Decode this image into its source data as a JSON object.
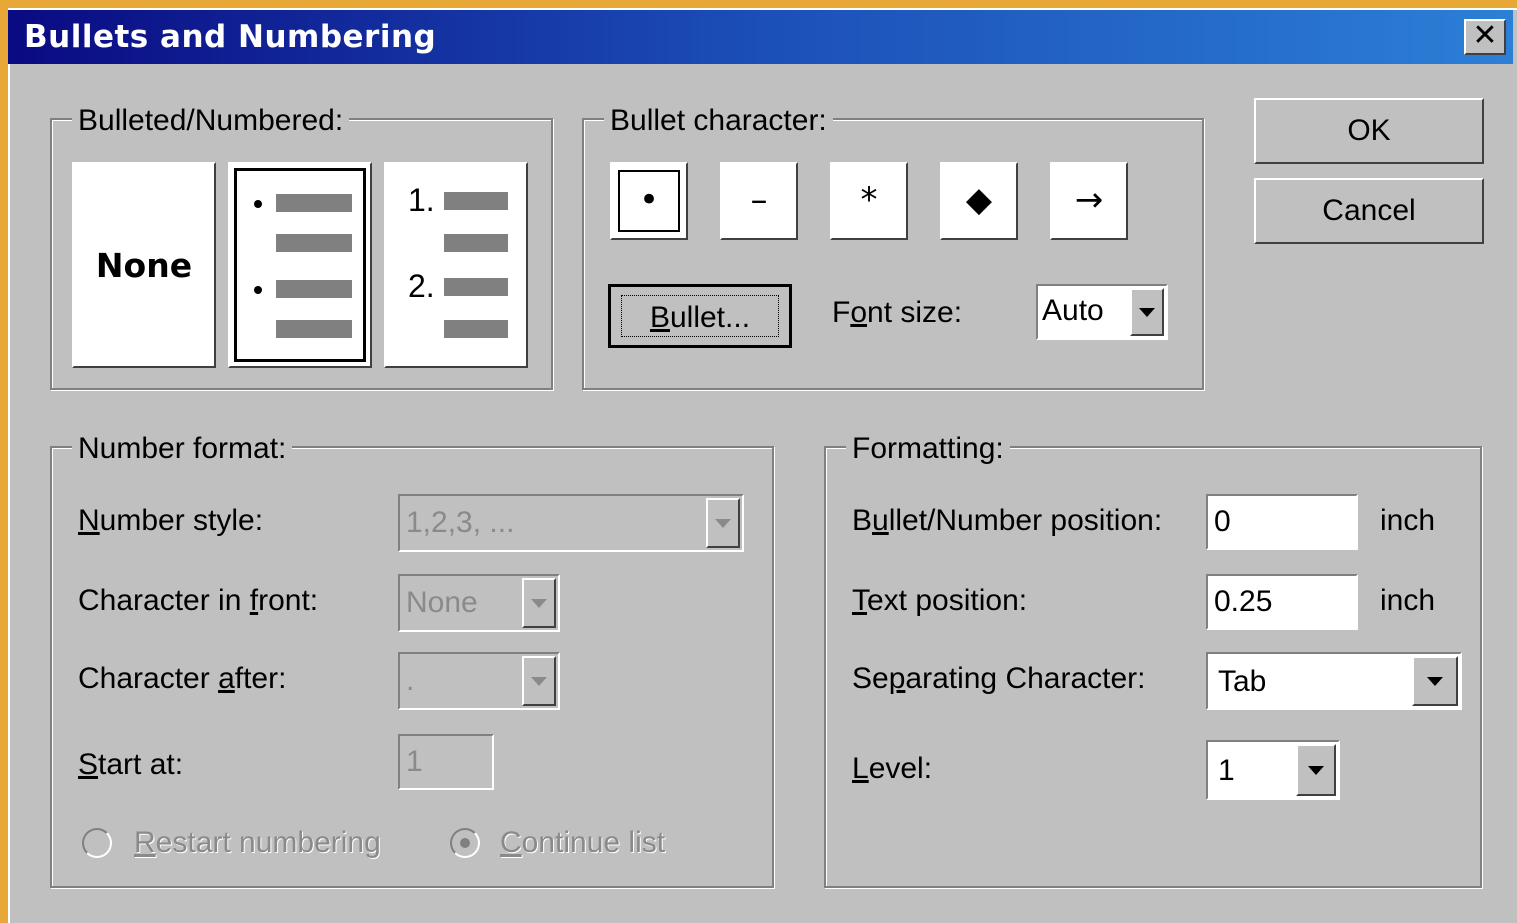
{
  "window": {
    "title": "Bullets and Numbering"
  },
  "close_glyph": "✕",
  "buttons": {
    "ok": "OK",
    "cancel": "Cancel"
  },
  "bulleted_numbered": {
    "legend": "Bulleted/Numbered:",
    "options": [
      "None",
      "Bulleted",
      "Numbered"
    ],
    "none_label": "None",
    "number_labels": [
      "1.",
      "2."
    ],
    "selected": "Bulleted"
  },
  "bullet_character": {
    "legend": "Bullet character:",
    "chars": [
      "•",
      "–",
      "*",
      "◆",
      "→"
    ],
    "selected_index": 0,
    "bullet_button": {
      "pre": "",
      "mnemonic": "B",
      "post": "ullet..."
    },
    "font_size": {
      "pre": "F",
      "mnemonic": "o",
      "post": "nt size:",
      "value": "Auto"
    }
  },
  "number_format": {
    "legend": "Number format:",
    "number_style": {
      "pre": "",
      "mnemonic": "N",
      "post": "umber style:",
      "value": "1,2,3, ..."
    },
    "char_front": {
      "pre": "Character in ",
      "mnemonic": "f",
      "post": "ront:",
      "value": "None"
    },
    "char_after": {
      "pre": "Character ",
      "mnemonic": "a",
      "post": "fter:",
      "value": "."
    },
    "start_at": {
      "pre": "",
      "mnemonic": "S",
      "post": "tart at:",
      "value": "1"
    },
    "restart": {
      "pre": "",
      "mnemonic": "R",
      "post": "estart numbering",
      "checked": false
    },
    "continue": {
      "pre": "",
      "mnemonic": "C",
      "post": "ontinue list",
      "checked": true
    }
  },
  "formatting": {
    "legend": "Formatting:",
    "bullet_pos": {
      "pre": "B",
      "mnemonic": "u",
      "post": "llet/Number position:",
      "value": "0",
      "unit": "inch"
    },
    "text_pos": {
      "pre": "",
      "mnemonic": "T",
      "post": "ext position:",
      "value": "0.25",
      "unit": "inch"
    },
    "sep_char": {
      "pre": "Se",
      "mnemonic": "p",
      "post": "arating Character:",
      "value": "Tab"
    },
    "level": {
      "pre": "",
      "mnemonic": "L",
      "post": "evel:",
      "value": "1"
    }
  }
}
